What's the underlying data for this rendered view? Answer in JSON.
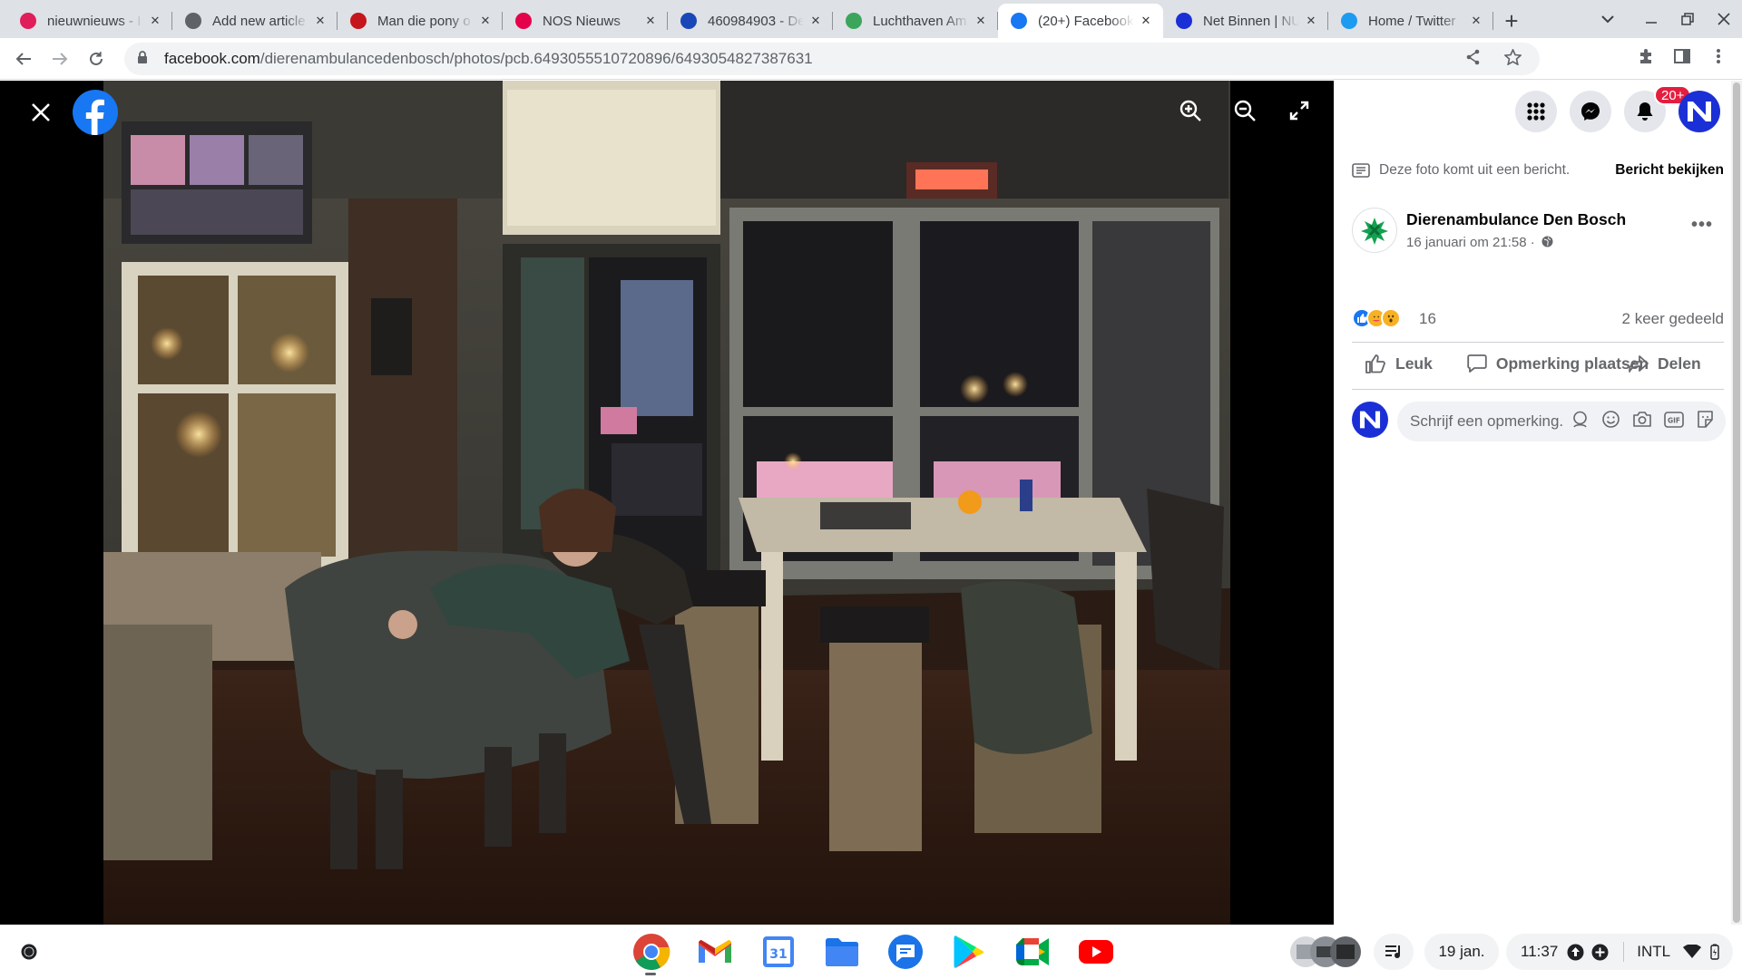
{
  "browser": {
    "tabs": [
      {
        "title": "nieuwnieuws - I",
        "icon": "slack-icon",
        "color": "#e01e5a",
        "active": false
      },
      {
        "title": "Add new article",
        "icon": "globe-icon",
        "color": "#5f6368",
        "active": false
      },
      {
        "title": "Man die pony o",
        "icon": "news-icon",
        "color": "#c4161c",
        "active": false
      },
      {
        "title": "NOS Nieuws",
        "icon": "nos-icon",
        "color": "#e5004b",
        "active": false
      },
      {
        "title": "460984903 - De",
        "icon": "anp-icon",
        "color": "#1a47b8",
        "active": false
      },
      {
        "title": "Luchthaven Am",
        "icon": "px-icon",
        "color": "#3ba55c",
        "active": false
      },
      {
        "title": "(20+) Facebook",
        "icon": "facebook-icon",
        "color": "#1877f2",
        "active": true
      },
      {
        "title": "Net Binnen | NU",
        "icon": "nu-icon",
        "color": "#1b2fd6",
        "active": false
      },
      {
        "title": "Home / Twitter",
        "icon": "twitter-icon",
        "color": "#1d9bf0",
        "active": false
      }
    ],
    "new_tab_label": "+",
    "url_host": "facebook.com",
    "url_path": "/dierenambulancedenbosch/photos/pcb.6493055510720896/6493054827387631"
  },
  "facebook": {
    "notifications_badge": "20+",
    "photo_notice": "Deze foto komt uit een bericht.",
    "view_post_link": "Bericht bekijken",
    "page_name": "Dierenambulance Den Bosch",
    "post_time": "16 januari om 21:58 ·",
    "reaction_count": "16",
    "share_count": "2 keer gedeeld",
    "actions": {
      "like": "Leuk",
      "comment": "Opmerking plaatsen",
      "share": "Delen"
    },
    "comment_placeholder": "Schrijf een opmerking..."
  },
  "shelf": {
    "apps": [
      {
        "name": "chrome-icon"
      },
      {
        "name": "gmail-icon"
      },
      {
        "name": "calendar-icon",
        "label": "31"
      },
      {
        "name": "files-icon"
      },
      {
        "name": "messages-icon"
      },
      {
        "name": "play-store-icon"
      },
      {
        "name": "meet-icon"
      },
      {
        "name": "youtube-icon"
      }
    ],
    "date": "19 jan.",
    "time": "11:37",
    "keyboard": "INTL"
  }
}
